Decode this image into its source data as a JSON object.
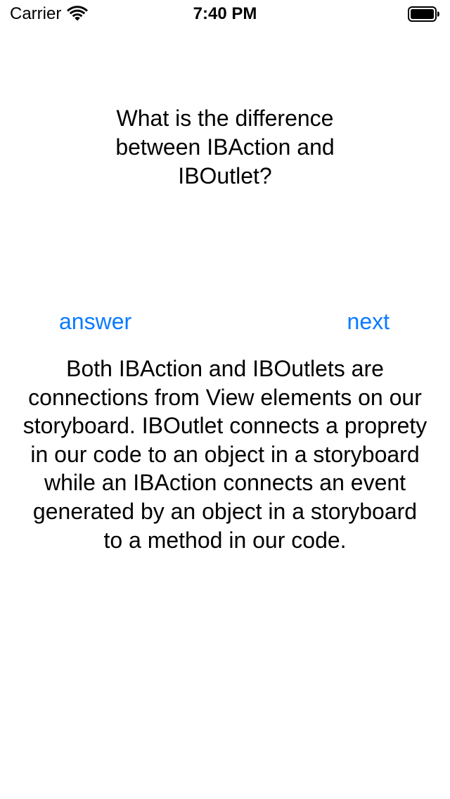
{
  "status_bar": {
    "carrier": "Carrier",
    "time": "7:40 PM",
    "wifi_icon": "wifi-icon",
    "battery_icon": "battery-icon"
  },
  "question": {
    "text": "What is the difference between IBAction and IBOutlet?"
  },
  "buttons": {
    "answer_label": "answer",
    "next_label": "next"
  },
  "answer": {
    "text": "Both IBAction and IBOutlets are connections from View elements on our storyboard. IBOutlet connects a proprety in our code to an object in a storyboard while an IBAction connects an event generated by an object in a storyboard to a method in our code."
  },
  "colors": {
    "tint": "#0a7aff",
    "background": "#ffffff",
    "text": "#000000"
  }
}
